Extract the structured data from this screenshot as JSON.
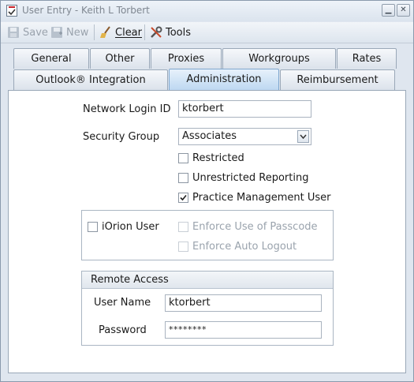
{
  "window": {
    "title": "User Entry - Keith L Torbert"
  },
  "toolbar": {
    "save_label": "Save",
    "new_label": "New",
    "clear_label": "Clear",
    "tools_label": "Tools"
  },
  "tabs_row1": [
    {
      "label": "General"
    },
    {
      "label": "Other"
    },
    {
      "label": "Proxies"
    },
    {
      "label": "Workgroups"
    },
    {
      "label": "Rates"
    }
  ],
  "tabs_row2": [
    {
      "label": "Outlook® Integration"
    },
    {
      "label": "Administration",
      "active": true
    },
    {
      "label": "Reimbursement"
    }
  ],
  "admin": {
    "network_login_label": "Network Login ID",
    "network_login_value": "ktorbert",
    "security_group_label": "Security Group",
    "security_group_value": "Associates",
    "restricted_label": "Restricted",
    "restricted_checked": false,
    "unrestricted_reporting_label": "Unrestricted Reporting",
    "unrestricted_reporting_checked": false,
    "practice_mgmt_label": "Practice Management User",
    "practice_mgmt_checked": true,
    "iorion_label": "iOrion User",
    "iorion_checked": false,
    "enforce_passcode_label": "Enforce Use of Passcode",
    "enforce_logout_label": "Enforce Auto Logout"
  },
  "remote_access": {
    "header": "Remote Access",
    "username_label": "User Name",
    "username_value": "ktorbert",
    "password_label": "Password",
    "password_value": "********"
  },
  "colors": {
    "active_tab": "#bcd7f1",
    "window_bg": "#dfe6ef"
  }
}
